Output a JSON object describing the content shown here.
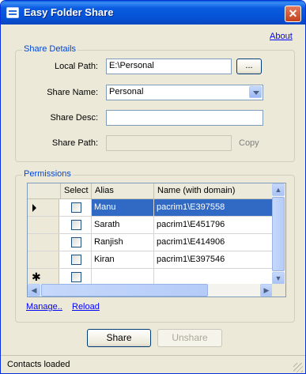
{
  "window": {
    "title": "Easy Folder Share",
    "close_glyph": "✕"
  },
  "about_link": "About",
  "share_details": {
    "legend": "Share Details",
    "local_path": {
      "label": "Local Path:",
      "value": "E:\\Personal",
      "browse_label": "..."
    },
    "share_name": {
      "label": "Share Name:",
      "value": "Personal"
    },
    "share_desc": {
      "label": "Share Desc:",
      "value": ""
    },
    "share_path": {
      "label": "Share Path:",
      "value": "",
      "copy_label": "Copy"
    }
  },
  "permissions": {
    "legend": "Permissions",
    "columns": [
      "Select",
      "Alias",
      "Name (with domain)"
    ],
    "rows": [
      {
        "alias": "Manu",
        "name": "pacrim1\\E397558",
        "selected": true,
        "checked": false
      },
      {
        "alias": "Sarath",
        "name": "pacrim1\\E451796",
        "selected": false,
        "checked": false
      },
      {
        "alias": "Ranjish",
        "name": "pacrim1\\E414906",
        "selected": false,
        "checked": false
      },
      {
        "alias": "Kiran",
        "name": "pacrim1\\E397546",
        "selected": false,
        "checked": false
      }
    ],
    "new_row_marker": "✱",
    "manage_link": "Manage..",
    "reload_link": "Reload"
  },
  "buttons": {
    "share": "Share",
    "unshare": "Unshare"
  },
  "status": "Contacts loaded",
  "colors": {
    "title_bar": "#0553d6",
    "selection": "#316ac5",
    "link": "#0000ff",
    "legend": "#0046d5"
  }
}
